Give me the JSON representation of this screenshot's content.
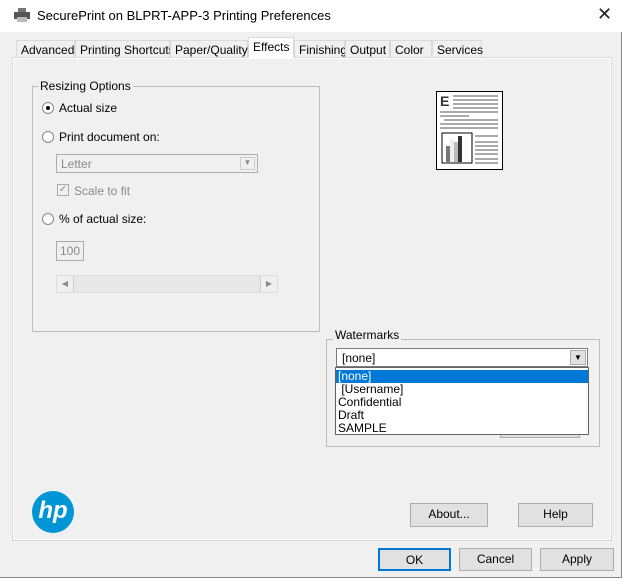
{
  "window": {
    "title": "SecurePrint on BLPRT-APP-3 Printing Preferences",
    "icon": "printer-icon",
    "close": "✕"
  },
  "tabs": [
    {
      "label": "Advanced"
    },
    {
      "label": "Printing Shortcuts"
    },
    {
      "label": "Paper/Quality"
    },
    {
      "label": "Effects",
      "active": true
    },
    {
      "label": "Finishing"
    },
    {
      "label": "Output"
    },
    {
      "label": "Color"
    },
    {
      "label": "Services"
    }
  ],
  "resizing": {
    "title": "Resizing Options",
    "actual_size": "Actual size",
    "print_on": "Print document on:",
    "paper_value": "Letter",
    "scale_to_fit": "Scale to fit",
    "scale_checked": true,
    "percent": "% of actual size:",
    "percent_value": "100",
    "selected": "actual_size"
  },
  "watermarks": {
    "title": "Watermarks",
    "selected": "[none]",
    "options": [
      "[none]",
      " [Username]",
      "Confidential",
      "Draft",
      "SAMPLE"
    ],
    "highlight_color": "#0078d7"
  },
  "buttons": {
    "about": "About...",
    "help": "Help",
    "ok": "OK",
    "cancel": "Cancel",
    "apply": "Apply"
  },
  "logo": {
    "text": "hp",
    "color": "#0096d6"
  }
}
